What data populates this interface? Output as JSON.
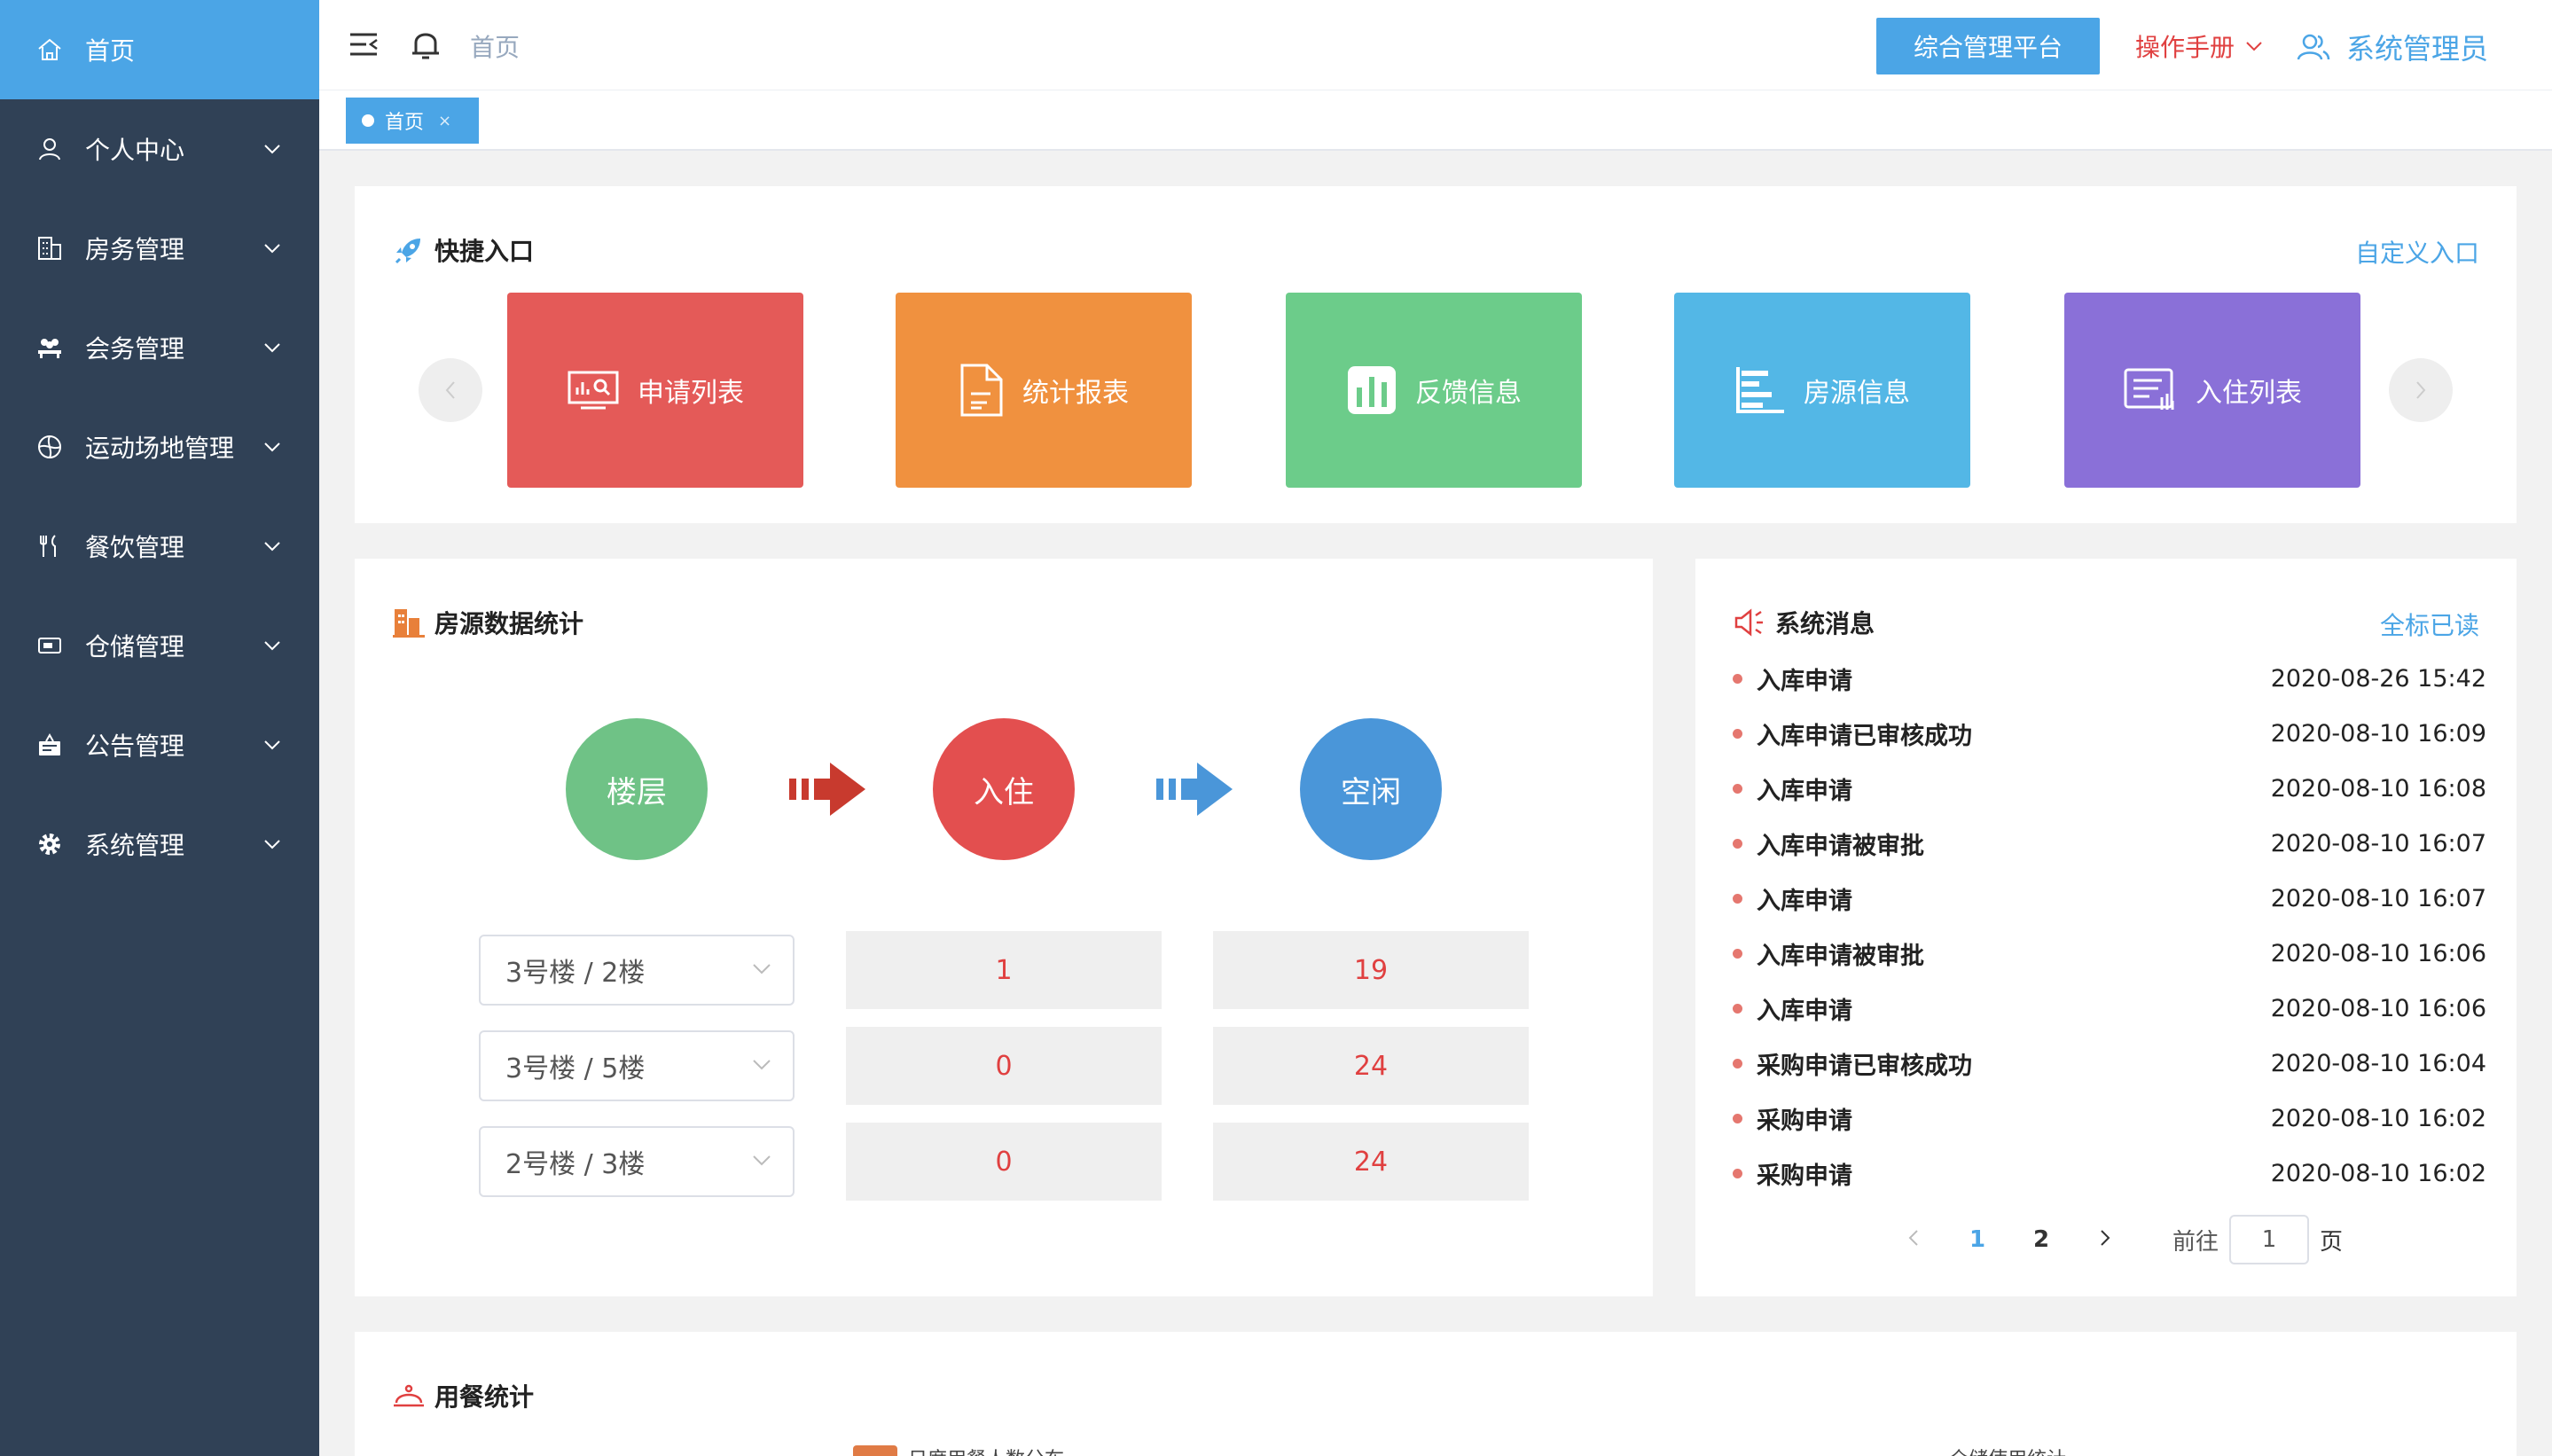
{
  "sidebar": {
    "items": [
      {
        "label": "首页",
        "icon": "home-icon",
        "active": true
      },
      {
        "label": "个人中心",
        "icon": "user-icon"
      },
      {
        "label": "房务管理",
        "icon": "building-icon"
      },
      {
        "label": "会务管理",
        "icon": "meeting-icon"
      },
      {
        "label": "运动场地管理",
        "icon": "ball-icon"
      },
      {
        "label": "餐饮管理",
        "icon": "fork-knife-icon"
      },
      {
        "label": "仓储管理",
        "icon": "storage-icon"
      },
      {
        "label": "公告管理",
        "icon": "notice-icon"
      },
      {
        "label": "系统管理",
        "icon": "gear-icon"
      }
    ]
  },
  "header": {
    "breadcrumb": "首页",
    "platform_button": "综合管理平台",
    "manual": "操作手册",
    "user": "系统管理员"
  },
  "tags": [
    {
      "label": "首页",
      "close": "×"
    }
  ],
  "quick": {
    "title": "快捷入口",
    "customize": "自定义入口",
    "tiles": [
      {
        "label": "申请列表",
        "icon": "monitor-chart-icon",
        "color": "#e45a58"
      },
      {
        "label": "统计报表",
        "icon": "document-icon",
        "color": "#f0913f"
      },
      {
        "label": "反馈信息",
        "icon": "bar-chart-icon",
        "color": "#6ccc8a"
      },
      {
        "label": "房源信息",
        "icon": "bar-list-icon",
        "color": "#53b7e6"
      },
      {
        "label": "入住列表",
        "icon": "list-icon",
        "color": "#8a70d8"
      }
    ]
  },
  "rooms": {
    "title": "房源数据统计",
    "circles": [
      {
        "label": "楼层",
        "color": "#6fc286"
      },
      {
        "label": "入住",
        "color": "#e34f4f"
      },
      {
        "label": "空闲",
        "color": "#4a96d9"
      }
    ],
    "rows": [
      {
        "floor": "3号楼 / 2楼",
        "occupied": "1",
        "free": "19"
      },
      {
        "floor": "3号楼 / 5楼",
        "occupied": "0",
        "free": "24"
      },
      {
        "floor": "2号楼 / 3楼",
        "occupied": "0",
        "free": "24"
      }
    ]
  },
  "messages": {
    "title": "系统消息",
    "mark_all": "全标已读",
    "items": [
      {
        "title": "入库申请",
        "time": "2020-08-26 15:42"
      },
      {
        "title": "入库申请已审核成功",
        "time": "2020-08-10 16:09"
      },
      {
        "title": "入库申请",
        "time": "2020-08-10 16:08"
      },
      {
        "title": "入库申请被审批",
        "time": "2020-08-10 16:07"
      },
      {
        "title": "入库申请",
        "time": "2020-08-10 16:07"
      },
      {
        "title": "入库申请被审批",
        "time": "2020-08-10 16:06"
      },
      {
        "title": "入库申请",
        "time": "2020-08-10 16:06"
      },
      {
        "title": "采购申请已审核成功",
        "time": "2020-08-10 16:04"
      },
      {
        "title": "采购申请",
        "time": "2020-08-10 16:02"
      },
      {
        "title": "采购申请",
        "time": "2020-08-10 16:02"
      }
    ],
    "pager": {
      "page1": "1",
      "page2": "2",
      "goto": "前往",
      "input": "1",
      "suffix": "页"
    }
  },
  "meals": {
    "title": "用餐统计",
    "legend1": "日度用餐人数分布",
    "legend2": "仓储使用统计"
  }
}
